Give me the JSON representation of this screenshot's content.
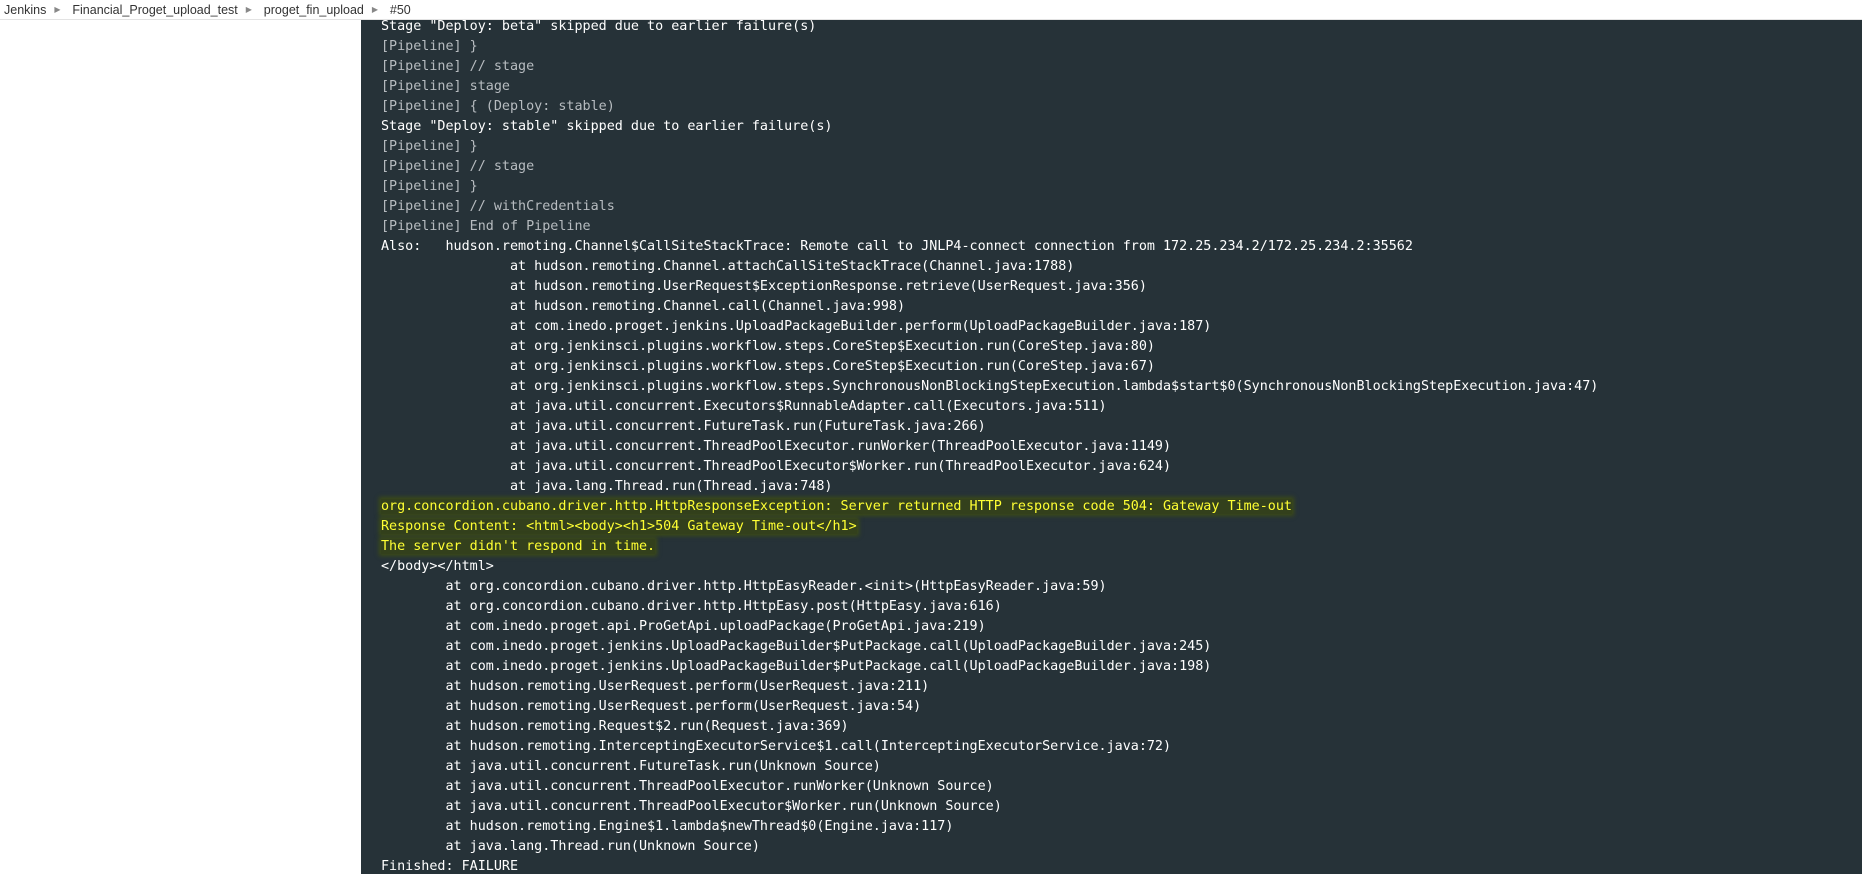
{
  "breadcrumb": {
    "items": [
      {
        "label": "Jenkins"
      },
      {
        "label": "Financial_Proget_upload_test"
      },
      {
        "label": "proget_fin_upload"
      },
      {
        "label": "#50"
      }
    ],
    "separator_icon": "chevron-right-icon"
  },
  "colors": {
    "console_bg": "#263238",
    "normal_text": "#ffffff",
    "pipeline_text": "#b7bcc0",
    "highlight_text": "#ffff33"
  },
  "console": {
    "lines": [
      {
        "text": "Stage \"Deploy: beta\" skipped due to earlier failure(s)",
        "style": "normal"
      },
      {
        "text": "[Pipeline] }",
        "style": "muted"
      },
      {
        "text": "[Pipeline] // stage",
        "style": "muted"
      },
      {
        "text": "[Pipeline] stage",
        "style": "muted"
      },
      {
        "text": "[Pipeline] { (Deploy: stable)",
        "style": "muted"
      },
      {
        "text": "Stage \"Deploy: stable\" skipped due to earlier failure(s)",
        "style": "normal"
      },
      {
        "text": "[Pipeline] }",
        "style": "muted"
      },
      {
        "text": "[Pipeline] // stage",
        "style": "muted"
      },
      {
        "text": "[Pipeline] }",
        "style": "muted"
      },
      {
        "text": "[Pipeline] // withCredentials",
        "style": "muted"
      },
      {
        "text": "[Pipeline] End of Pipeline",
        "style": "muted"
      },
      {
        "text": "Also:   hudson.remoting.Channel$CallSiteStackTrace: Remote call to JNLP4-connect connection from 172.25.234.2/172.25.234.2:35562",
        "style": "normal"
      },
      {
        "text": "                at hudson.remoting.Channel.attachCallSiteStackTrace(Channel.java:1788)",
        "style": "normal"
      },
      {
        "text": "                at hudson.remoting.UserRequest$ExceptionResponse.retrieve(UserRequest.java:356)",
        "style": "normal"
      },
      {
        "text": "                at hudson.remoting.Channel.call(Channel.java:998)",
        "style": "normal"
      },
      {
        "text": "                at com.inedo.proget.jenkins.UploadPackageBuilder.perform(UploadPackageBuilder.java:187)",
        "style": "normal"
      },
      {
        "text": "                at org.jenkinsci.plugins.workflow.steps.CoreStep$Execution.run(CoreStep.java:80)",
        "style": "normal"
      },
      {
        "text": "                at org.jenkinsci.plugins.workflow.steps.CoreStep$Execution.run(CoreStep.java:67)",
        "style": "normal"
      },
      {
        "text": "                at org.jenkinsci.plugins.workflow.steps.SynchronousNonBlockingStepExecution.lambda$start$0(SynchronousNonBlockingStepExecution.java:47)",
        "style": "normal"
      },
      {
        "text": "                at java.util.concurrent.Executors$RunnableAdapter.call(Executors.java:511)",
        "style": "normal"
      },
      {
        "text": "                at java.util.concurrent.FutureTask.run(FutureTask.java:266)",
        "style": "normal"
      },
      {
        "text": "                at java.util.concurrent.ThreadPoolExecutor.runWorker(ThreadPoolExecutor.java:1149)",
        "style": "normal"
      },
      {
        "text": "                at java.util.concurrent.ThreadPoolExecutor$Worker.run(ThreadPoolExecutor.java:624)",
        "style": "normal"
      },
      {
        "text": "                at java.lang.Thread.run(Thread.java:748)",
        "style": "normal"
      },
      {
        "text": "org.concordion.cubano.driver.http.HttpResponseException: Server returned HTTP response code 504: Gateway Time-out",
        "style": "hl"
      },
      {
        "text": "Response Content: <html><body><h1>504 Gateway Time-out</h1>",
        "style": "hl"
      },
      {
        "text": "The server didn't respond in time.",
        "style": "hl"
      },
      {
        "text": "</body></html>",
        "style": "normal"
      },
      {
        "text": "        at org.concordion.cubano.driver.http.HttpEasyReader.<init>(HttpEasyReader.java:59)",
        "style": "normal"
      },
      {
        "text": "        at org.concordion.cubano.driver.http.HttpEasy.post(HttpEasy.java:616)",
        "style": "normal"
      },
      {
        "text": "        at com.inedo.proget.api.ProGetApi.uploadPackage(ProGetApi.java:219)",
        "style": "normal"
      },
      {
        "text": "        at com.inedo.proget.jenkins.UploadPackageBuilder$PutPackage.call(UploadPackageBuilder.java:245)",
        "style": "normal"
      },
      {
        "text": "        at com.inedo.proget.jenkins.UploadPackageBuilder$PutPackage.call(UploadPackageBuilder.java:198)",
        "style": "normal"
      },
      {
        "text": "        at hudson.remoting.UserRequest.perform(UserRequest.java:211)",
        "style": "normal"
      },
      {
        "text": "        at hudson.remoting.UserRequest.perform(UserRequest.java:54)",
        "style": "normal"
      },
      {
        "text": "        at hudson.remoting.Request$2.run(Request.java:369)",
        "style": "normal"
      },
      {
        "text": "        at hudson.remoting.InterceptingExecutorService$1.call(InterceptingExecutorService.java:72)",
        "style": "normal"
      },
      {
        "text": "        at java.util.concurrent.FutureTask.run(Unknown Source)",
        "style": "normal"
      },
      {
        "text": "        at java.util.concurrent.ThreadPoolExecutor.runWorker(Unknown Source)",
        "style": "normal"
      },
      {
        "text": "        at java.util.concurrent.ThreadPoolExecutor$Worker.run(Unknown Source)",
        "style": "normal"
      },
      {
        "text": "        at hudson.remoting.Engine$1.lambda$newThread$0(Engine.java:117)",
        "style": "normal"
      },
      {
        "text": "        at java.lang.Thread.run(Unknown Source)",
        "style": "normal"
      },
      {
        "text": "Finished: FAILURE",
        "style": "normal"
      }
    ]
  }
}
